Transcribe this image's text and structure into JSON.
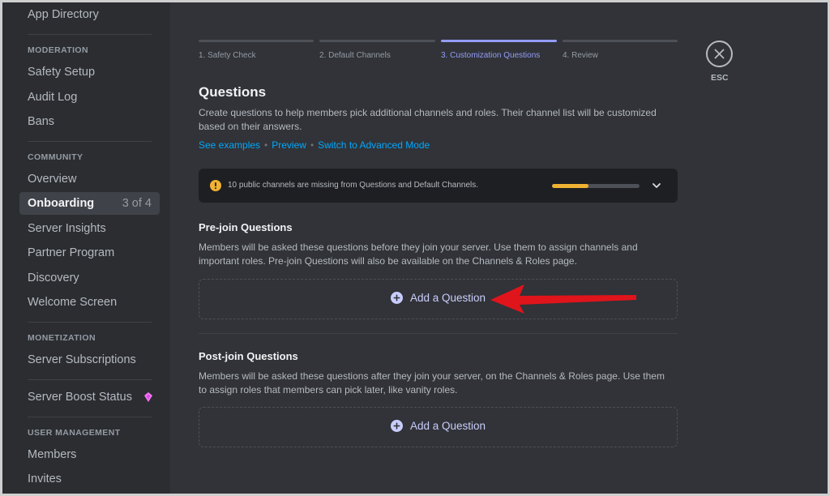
{
  "sidebar": {
    "top_item": "App Directory",
    "moderation_header": "MODERATION",
    "moderation_items": [
      "Safety Setup",
      "Audit Log",
      "Bans"
    ],
    "community_header": "COMMUNITY",
    "community_items": [
      "Overview",
      "Onboarding",
      "Server Insights",
      "Partner Program",
      "Discovery",
      "Welcome Screen"
    ],
    "onboarding_count": "3 of 4",
    "monetization_header": "MONETIZATION",
    "monetization_items": [
      "Server Subscriptions"
    ],
    "boost_item": "Server Boost Status",
    "user_mgmt_header": "USER MANAGEMENT",
    "user_mgmt_items": [
      "Members",
      "Invites"
    ]
  },
  "steps": [
    {
      "label": "1. Safety Check"
    },
    {
      "label": "2. Default Channels"
    },
    {
      "label": "3. Customization Questions"
    },
    {
      "label": "4. Review"
    }
  ],
  "active_step": 3,
  "esc_label": "ESC",
  "questions": {
    "title": "Questions",
    "description": "Create questions to help members pick additional channels and roles. Their channel list will be customized based on their answers.",
    "links": [
      "See examples",
      "Preview",
      "Switch to Advanced Mode"
    ]
  },
  "warning": {
    "text": "10 public channels are missing from Questions and Default Channels.",
    "progress": 0.42
  },
  "pre_join": {
    "title": "Pre-join Questions",
    "description": "Members will be asked these questions before they join your server. Use them to assign channels and important roles. Pre-join Questions will also be available on the Channels & Roles page.",
    "add_label": "Add a Question"
  },
  "post_join": {
    "title": "Post-join Questions",
    "description": "Members will be asked these questions after they join your server, on the Channels & Roles page. Use them to assign roles that members can pick later, like vanity roles.",
    "add_label": "Add a Question"
  },
  "colors": {
    "accent": "#949cf7",
    "link": "#00a8fc",
    "warning": "#f0b232",
    "arrow": "#e0141b"
  }
}
